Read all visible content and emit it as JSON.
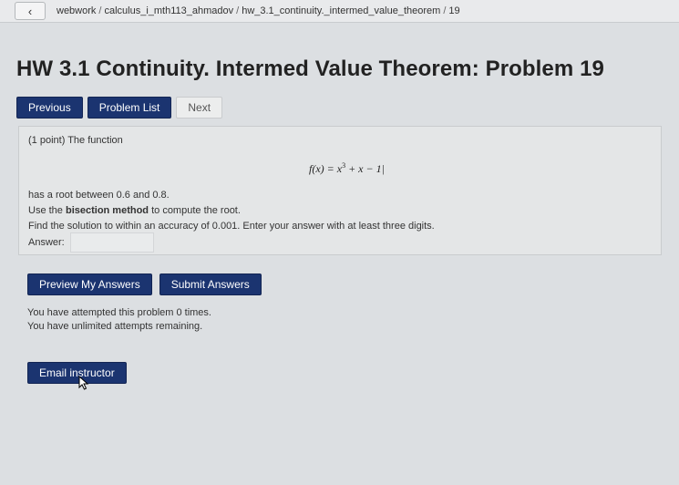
{
  "breadcrumb": {
    "back_icon": "chevron-left-icon",
    "items": [
      "webwork",
      "calculus_i_mth113_ahmadov",
      "hw_3.1_continuity._intermed_value_theorem",
      "19"
    ],
    "separator": "/"
  },
  "page_title": "HW 3.1 Continuity. Intermed Value Theorem: Problem 19",
  "nav": {
    "previous_label": "Previous",
    "problem_list_label": "Problem List",
    "next_label": "Next"
  },
  "problem": {
    "intro": "(1 point) The function",
    "formula_lhs": "f(x) = x",
    "formula_exp": "3",
    "formula_rhs": " + x − 1|",
    "line1": "has a root between 0.6 and 0.8.",
    "line2_prefix": "Use the ",
    "line2_bold": "bisection method",
    "line2_suffix": " to compute the root.",
    "line3": "Find the solution to within an accuracy of 0.001. Enter your answer with at least three digits.",
    "answer_label": "Answer:",
    "answer_value": ""
  },
  "actions": {
    "preview_label": "Preview My Answers",
    "submit_label": "Submit Answers"
  },
  "attempts": {
    "line1": "You have attempted this problem 0 times.",
    "line2": "You have unlimited attempts remaining."
  },
  "email_label": "Email instructor",
  "colors": {
    "primary_button": "#1b3470",
    "page_background": "#dcdfe2",
    "problem_background": "#e4e6e7"
  }
}
